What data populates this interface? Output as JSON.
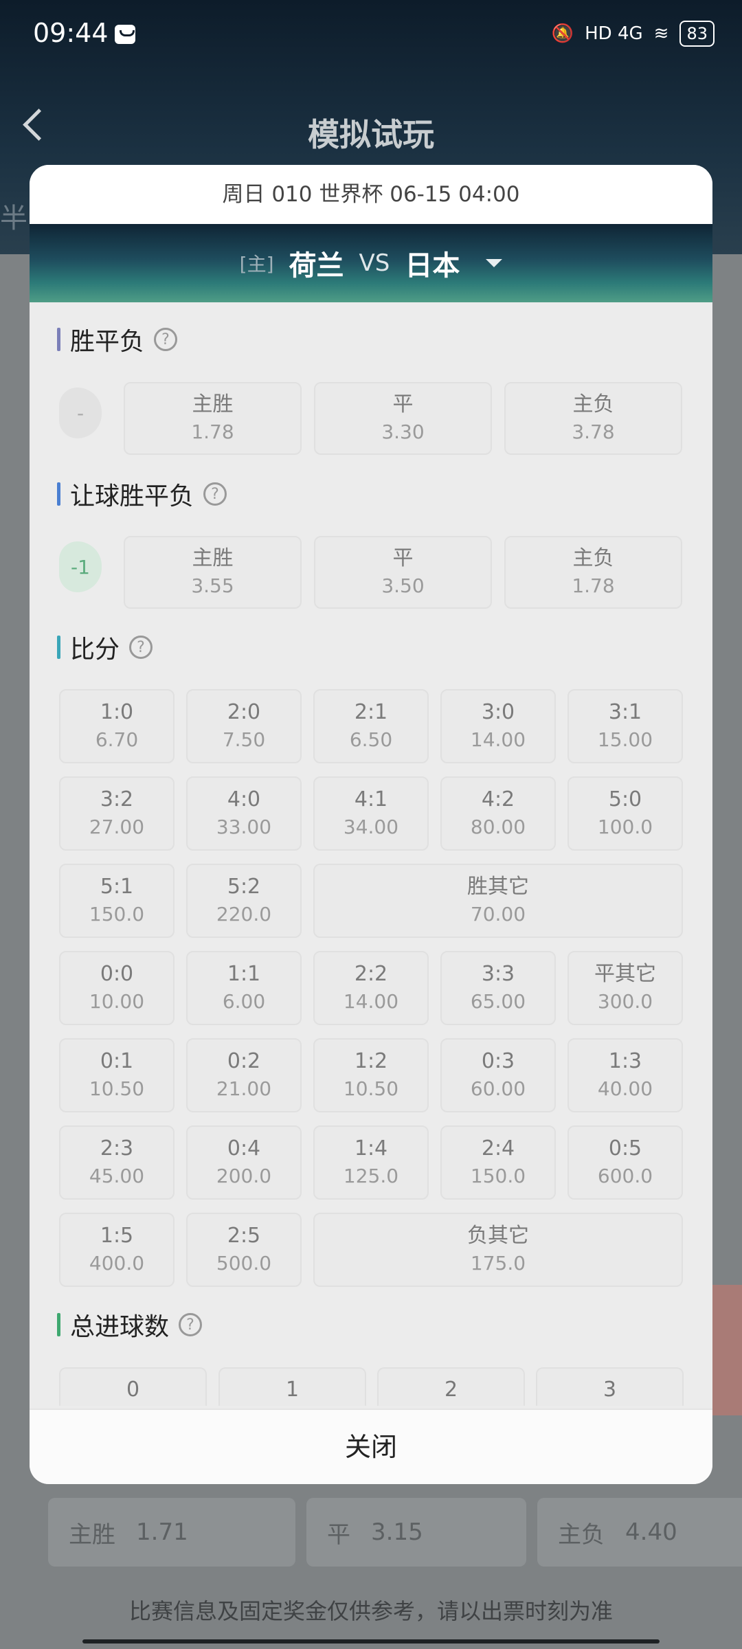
{
  "status": {
    "time": "09:44",
    "network": "HD 4G",
    "battery": "83"
  },
  "page": {
    "title": "模拟试玩",
    "left_partial": "半"
  },
  "background": {
    "row": {
      "home_label": "主胜",
      "home_odd": "1.71",
      "draw_label": "平",
      "draw_odd": "3.15",
      "away_label": "主负",
      "away_odd": "4.40"
    },
    "footer": "比赛信息及固定奖金仅供参考，请以出票时刻为准"
  },
  "modal": {
    "header": "周日 010 世界杯 06-15 04:00",
    "home_tag": "[主]",
    "home_team": "荷兰",
    "vs": "VS",
    "away_team": "日本",
    "close": "关闭"
  },
  "sections": {
    "wdl": {
      "title": "胜平负",
      "handicap": "-",
      "options": [
        {
          "label": "主胜",
          "odd": "1.78"
        },
        {
          "label": "平",
          "odd": "3.30"
        },
        {
          "label": "主负",
          "odd": "3.78"
        }
      ]
    },
    "hwdl": {
      "title": "让球胜平负",
      "handicap": "-1",
      "options": [
        {
          "label": "主胜",
          "odd": "3.55"
        },
        {
          "label": "平",
          "odd": "3.50"
        },
        {
          "label": "主负",
          "odd": "1.78"
        }
      ]
    },
    "score": {
      "title": "比分",
      "rows": [
        [
          {
            "label": "1:0",
            "odd": "6.70"
          },
          {
            "label": "2:0",
            "odd": "7.50"
          },
          {
            "label": "2:1",
            "odd": "6.50"
          },
          {
            "label": "3:0",
            "odd": "14.00"
          },
          {
            "label": "3:1",
            "odd": "15.00"
          }
        ],
        [
          {
            "label": "3:2",
            "odd": "27.00"
          },
          {
            "label": "4:0",
            "odd": "33.00"
          },
          {
            "label": "4:1",
            "odd": "34.00"
          },
          {
            "label": "4:2",
            "odd": "80.00"
          },
          {
            "label": "5:0",
            "odd": "100.0"
          }
        ],
        [
          {
            "label": "5:1",
            "odd": "150.0"
          },
          {
            "label": "5:2",
            "odd": "220.0"
          },
          {
            "label": "胜其它",
            "odd": "70.00"
          }
        ],
        [
          {
            "label": "0:0",
            "odd": "10.00"
          },
          {
            "label": "1:1",
            "odd": "6.00"
          },
          {
            "label": "2:2",
            "odd": "14.00"
          },
          {
            "label": "3:3",
            "odd": "65.00"
          },
          {
            "label": "平其它",
            "odd": "300.0"
          }
        ],
        [
          {
            "label": "0:1",
            "odd": "10.50"
          },
          {
            "label": "0:2",
            "odd": "21.00"
          },
          {
            "label": "1:2",
            "odd": "10.50"
          },
          {
            "label": "0:3",
            "odd": "60.00"
          },
          {
            "label": "1:3",
            "odd": "40.00"
          }
        ],
        [
          {
            "label": "2:3",
            "odd": "45.00"
          },
          {
            "label": "0:4",
            "odd": "200.0"
          },
          {
            "label": "1:4",
            "odd": "125.0"
          },
          {
            "label": "2:4",
            "odd": "150.0"
          },
          {
            "label": "0:5",
            "odd": "600.0"
          }
        ],
        [
          {
            "label": "1:5",
            "odd": "400.0"
          },
          {
            "label": "2:5",
            "odd": "500.0"
          },
          {
            "label": "负其它",
            "odd": "175.0"
          }
        ]
      ]
    },
    "goals": {
      "title": "总进球数",
      "options": [
        "0",
        "1",
        "2",
        "3"
      ]
    }
  },
  "colors": {
    "wdl_bar": "#7b7fb8",
    "hwdl_bar": "#4a7fd1",
    "score_bar": "#3aa6b8",
    "goals_bar": "#3fa870"
  }
}
